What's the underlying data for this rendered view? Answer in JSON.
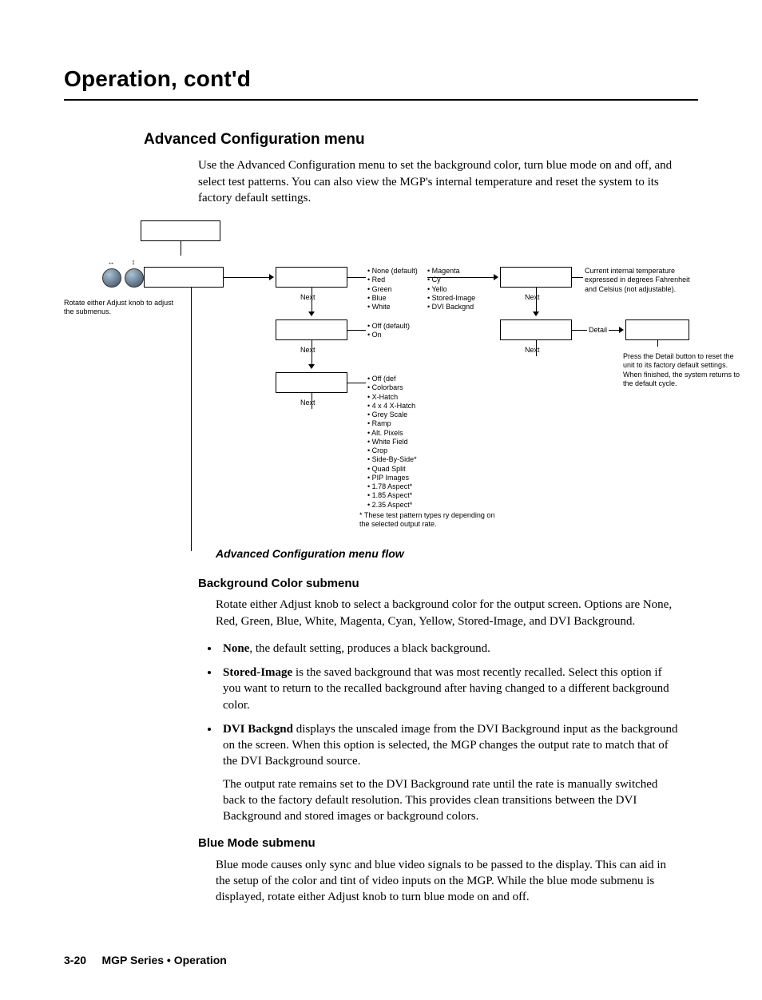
{
  "chapter_title": "Operation, cont'd",
  "section_h2": "Advanced Configuration menu",
  "intro_para": "Use the Advanced Configuration menu to set the background color, turn blue mode on and off, and select test patterns.  You can also view the MGP's internal temperature and reset the system to its factory default settings.",
  "diagram": {
    "rotate_note": "Rotate either Adjust knob to adjust the submenus.",
    "next": "Next",
    "detail": "Detail",
    "bg_colors_col1": [
      "None (default)",
      "Red",
      "Green",
      "Blue",
      "White"
    ],
    "bg_colors_col2": [
      "Magenta",
      "Cy",
      "Yello",
      "Stored-Image",
      "DVI Backgnd"
    ],
    "blue_mode_options": [
      "Off (default)",
      "On"
    ],
    "test_patterns": [
      "Off (def",
      "Colorbars",
      "X-Hatch",
      "4 x 4 X-Hatch",
      "Grey Scale",
      "Ramp",
      "Alt. Pixels",
      "White Field",
      "Crop",
      "Side-By-Side*",
      "Quad Split",
      "PIP Images",
      "1.78 Aspect*",
      "1.85 Aspect*",
      "2.35 Aspect*"
    ],
    "test_pattern_note": "*  These test pattern types       ry depending on the selected output rate.",
    "temp_note": "Current internal temperature expressed in degrees Fahrenheit and Celsius (not adjustable).",
    "reset_note": "Press the Detail button to reset the unit to its factory default settings.\nWhen finished, the system returns to the default cycle."
  },
  "caption": "Advanced Configuration menu flow",
  "bg_sub_head": "Background Color submenu",
  "bg_sub_para": "Rotate either Adjust knob to select a background color for the output screen.  Options are None, Red, Green, Blue, White, Magenta, Cyan, Yellow, Stored-Image, and DVI Background.",
  "bg_bullets": {
    "none_bold": "None",
    "none_rest": ", the default setting, produces a black background.",
    "stored_bold": "Stored-Image",
    "stored_rest": " is the saved background that was most recently recalled.  Select this option if you want to return to the recalled background after having changed to a different background color.",
    "dvi_bold": "DVI Backgnd",
    "dvi_rest": " displays the unscaled image from the DVI Background input as the background on the screen.  When this option is selected, the MGP changes the output rate to match that of the DVI Background source.",
    "dvi_para2": "The output rate remains set to the DVI Background rate until the rate is manually switched back to the factory default resolution.  This provides clean transitions between the DVI Background and stored images or background colors."
  },
  "blue_sub_head": "Blue Mode submenu",
  "blue_sub_para": "Blue mode causes only sync and blue video signals to be passed to the display.  This can aid in the setup of the color and tint of video inputs on the MGP.  While the blue mode submenu is displayed, rotate either Adjust knob to turn blue mode on and off.",
  "footer": {
    "pagenum": "3-20",
    "product": "MGP Series • Operation"
  }
}
